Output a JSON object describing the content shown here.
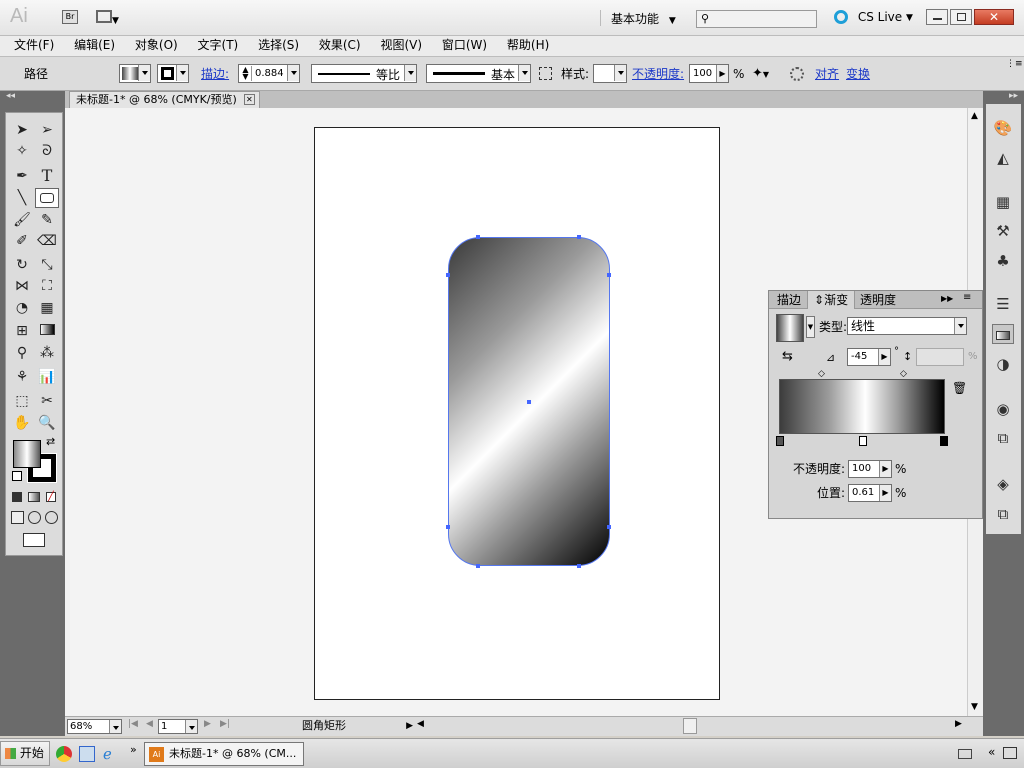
{
  "titlebar": {
    "logo": "Ai",
    "bridge": "Br",
    "workspace": "基本功能",
    "search_placeholder": "",
    "cslive": "CS Live"
  },
  "menu": [
    "文件(F)",
    "编辑(E)",
    "对象(O)",
    "文字(T)",
    "选择(S)",
    "效果(C)",
    "视图(V)",
    "窗口(W)",
    "帮助(H)"
  ],
  "control": {
    "object_type": "路径",
    "stroke_label": "描边:",
    "stroke_weight": "0.884 p",
    "profile1": "等比",
    "profile2": "基本",
    "style_label": "样式:",
    "opacity_label": "不透明度:",
    "opacity_value": "100",
    "opacity_unit": "%",
    "align": "对齐",
    "transform": "变换"
  },
  "document": {
    "tab_title": "未标题-1* @ 68% (CMYK/预览)"
  },
  "status": {
    "zoom": "68%",
    "page": "1",
    "tool_name": "圆角矩形"
  },
  "gradient_panel": {
    "tabs": [
      "描边",
      "渐变",
      "透明度"
    ],
    "type_label": "类型:",
    "type_value": "线性",
    "angle_value": "-45",
    "angle_unit": "°",
    "aspect_unit": "%",
    "opacity_label": "不透明度:",
    "opacity_value": "100",
    "opacity_unit": "%",
    "position_label": "位置:",
    "position_value": "0.61",
    "position_unit": "%"
  },
  "taskbar": {
    "start": "开始",
    "task": "未标题-1* @ 68% (CM..."
  },
  "colors": {
    "shape_outline": "#5577ee",
    "link_blue": "#1c39c8"
  }
}
